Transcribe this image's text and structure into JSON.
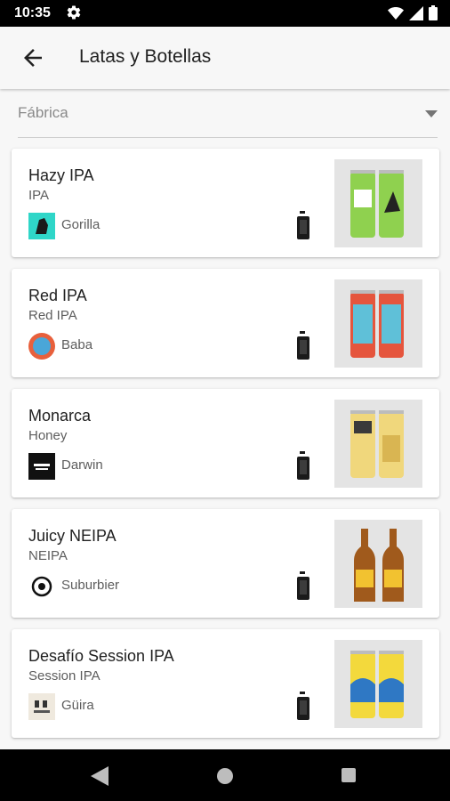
{
  "status_bar": {
    "time": "10:35"
  },
  "app_bar": {
    "title": "Latas y Botellas"
  },
  "filter": {
    "label": "Fábrica"
  },
  "items": [
    {
      "name": "Hazy IPA",
      "style": "IPA",
      "brewery": "Gorilla",
      "container": "can-icon"
    },
    {
      "name": "Red IPA",
      "style": "Red IPA",
      "brewery": "Baba",
      "container": "can-icon"
    },
    {
      "name": "Monarca",
      "style": "Honey",
      "brewery": "Darwin",
      "container": "can-icon"
    },
    {
      "name": "Juicy NEIPA",
      "style": "NEIPA",
      "brewery": "Suburbier",
      "container": "can-icon"
    },
    {
      "name": "Desafío Session IPA",
      "style": "Session IPA",
      "brewery": "Güira",
      "container": "can-icon"
    }
  ],
  "colors": {
    "background": "#f7f7f7",
    "card": "#ffffff",
    "text_primary": "#212121",
    "text_secondary": "#5d5d5d"
  }
}
